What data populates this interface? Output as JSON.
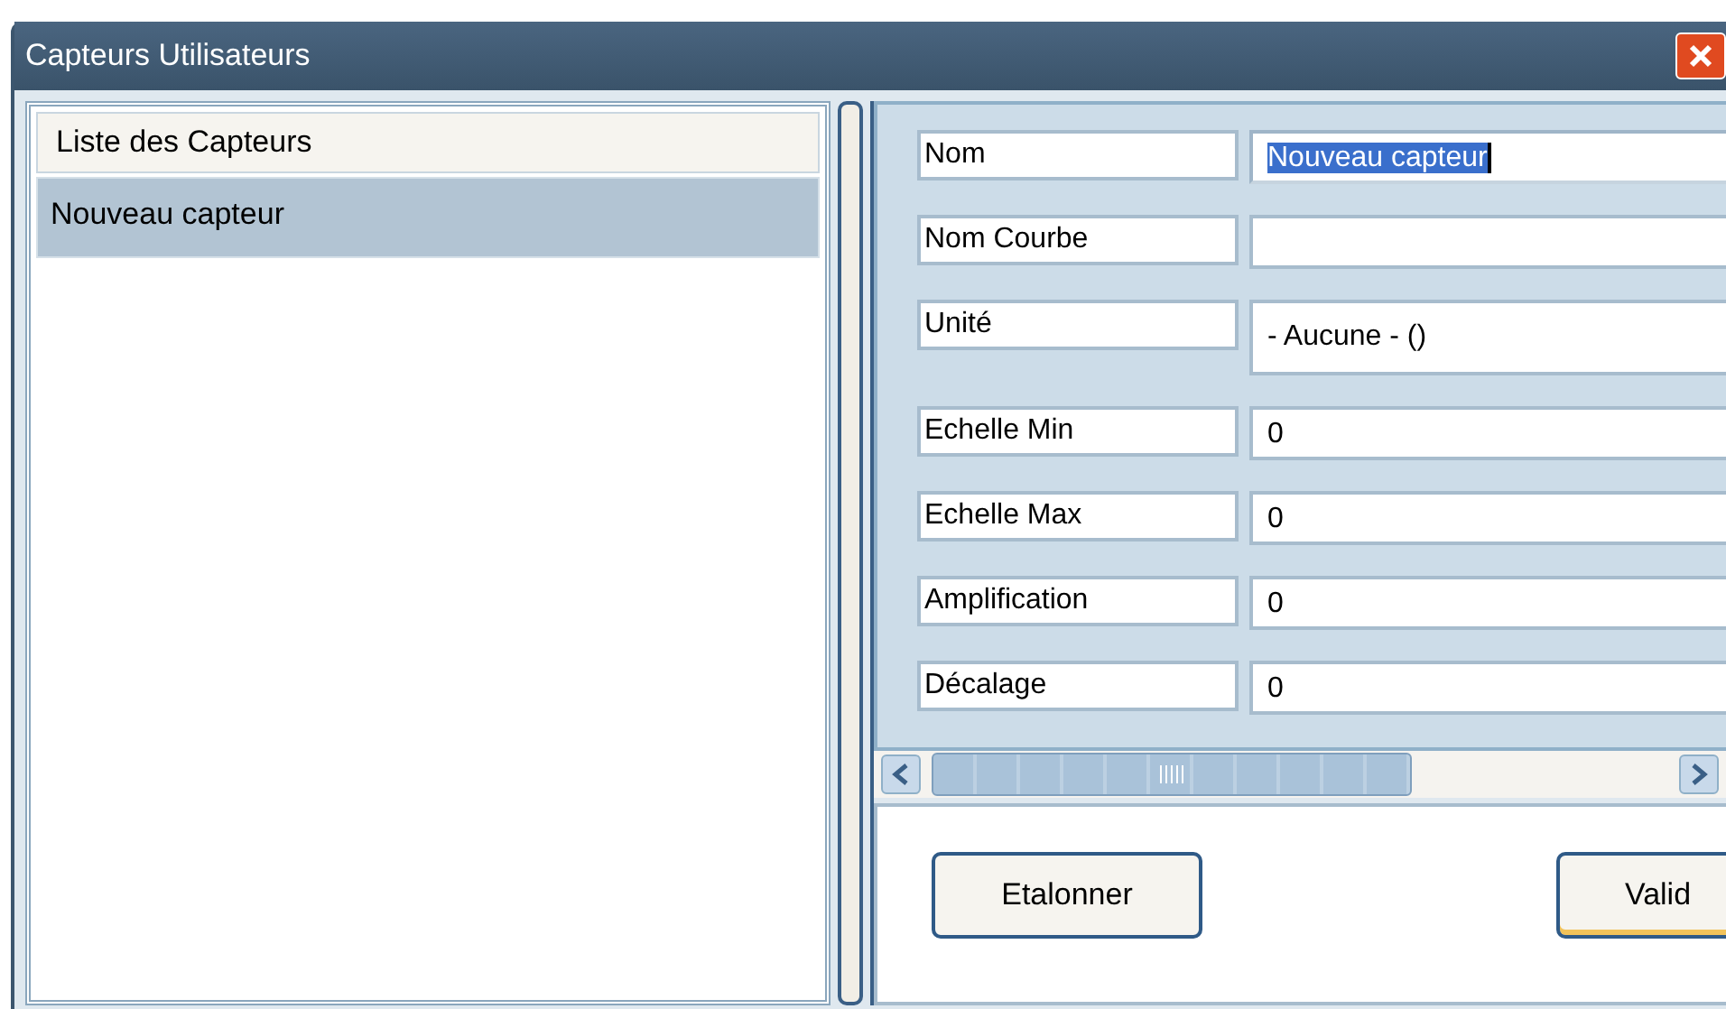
{
  "window": {
    "title": "Capteurs Utilisateurs"
  },
  "sensor_list": {
    "header": "Liste des Capteurs",
    "items": [
      {
        "label": "Nouveau capteur",
        "selected": true
      }
    ]
  },
  "form": {
    "fields": [
      {
        "label": "Nom",
        "value": "Nouveau capteur",
        "kind": "text",
        "text_selected": true
      },
      {
        "label": "Nom Courbe",
        "kind": "text",
        "text_selected": false
      },
      {
        "label": "Unité",
        "value": "- Aucune - ()",
        "kind": "select",
        "text_selected": false
      },
      {
        "label": "Echelle Min",
        "value": "0",
        "kind": "text",
        "text_selected": false
      },
      {
        "label": "Echelle Max",
        "value": "0",
        "kind": "text",
        "text_selected": false
      },
      {
        "label": "Amplification",
        "value": "0",
        "kind": "text",
        "text_selected": false
      },
      {
        "label": "Décalage",
        "value": "0",
        "kind": "text",
        "text_selected": false
      }
    ]
  },
  "buttons": [
    "Etalonner",
    "Valid"
  ]
}
